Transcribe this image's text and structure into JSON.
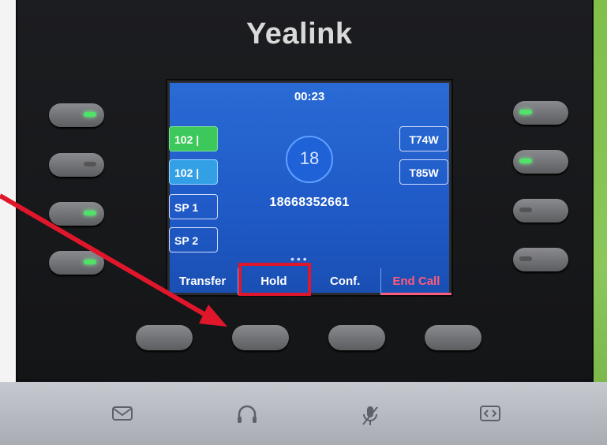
{
  "brand": "Yealink",
  "screen": {
    "call_time": "00:23",
    "left_keys": [
      {
        "label": "102 |",
        "state": "active"
      },
      {
        "label": "102 |",
        "state": "selected"
      },
      {
        "label": "SP 1",
        "state": "normal"
      },
      {
        "label": "SP 2",
        "state": "normal"
      }
    ],
    "right_keys": [
      {
        "label": "T74W"
      },
      {
        "label": "T85W"
      }
    ],
    "contact_badge": "18",
    "phone_number": "18668352661",
    "page_dots": "•••",
    "softkeys": [
      "Transfer",
      "Hold",
      "Conf.",
      "End Call"
    ]
  },
  "highlight_target": "Hold",
  "colors": {
    "screen_bg": "#1f5ac7",
    "active_key": "#3cc85a",
    "selected_key": "#33a0e6",
    "end_call": "#ff5a7a",
    "annotation_red": "#e0162b",
    "led_green": "#4fe36a"
  },
  "footer_icons": [
    "mail-icon",
    "headset-icon",
    "mute-mic-icon",
    "navigate-icon"
  ]
}
